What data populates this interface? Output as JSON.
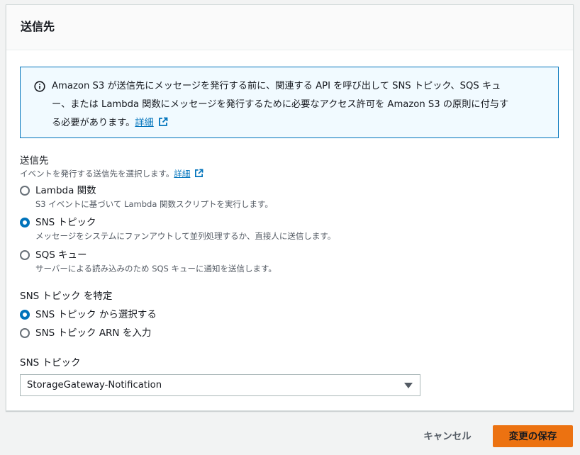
{
  "panel": {
    "title": "送信先"
  },
  "info": {
    "line1": "Amazon S3 が送信先にメッセージを発行する前に、関連する API を呼び出して SNS トピック、SQS キュ",
    "line2": "ー、または Lambda 関数にメッセージを発行するために必要なアクセス許可を Amazon S3 の原則に付与す",
    "line3": "る必要があります。",
    "link": "詳細"
  },
  "destination": {
    "label": "送信先",
    "description": "イベントを発行する送信先を選択します。",
    "link": "詳細",
    "options": [
      {
        "label": "Lambda 関数",
        "description": "S3 イベントに基づいて Lambda 関数スクリプトを実行します。",
        "checked": false
      },
      {
        "label": "SNS トピック",
        "description": "メッセージをシステムにファンアウトして並列処理するか、直接人に送信します。",
        "checked": true
      },
      {
        "label": "SQS キュー",
        "description": "サーバーによる読み込みのため SQS キューに通知を送信します。",
        "checked": false
      }
    ]
  },
  "specify": {
    "label": "SNS トピック を特定",
    "options": [
      {
        "label": "SNS トピック から選択する",
        "checked": true
      },
      {
        "label": "SNS トピック ARN を入力",
        "checked": false
      }
    ]
  },
  "topic": {
    "label": "SNS トピック",
    "selected": "StorageGateway-Notification"
  },
  "footer": {
    "cancel_label": "キャンセル",
    "save_label": "変更の保存"
  },
  "colors": {
    "accent": "#0073bb",
    "primary_button": "#ec7211",
    "info_background": "#f1faff"
  }
}
